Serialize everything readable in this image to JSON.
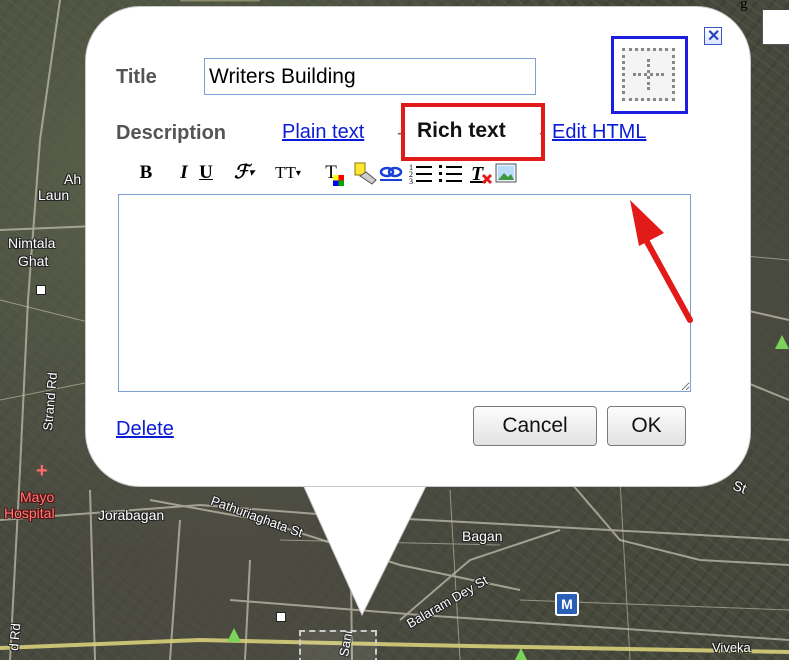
{
  "map": {
    "labels": {
      "ah": "Ah",
      "laun": "Laun",
      "nimtala": "Nimtala",
      "ghat": "Ghat",
      "strand_rd": "Strand Rd",
      "d_rd": "d Rd",
      "mayo": "Mayo",
      "hospital": "Hospital",
      "jorabagan": "Jorabagan",
      "pathuriaghata": "Pathuriaghata St",
      "bagan": "Bagan",
      "balaram": "Balaram Dey St",
      "st": "St",
      "vivek": "Viveka",
      "sani": "Sani",
      "top_corner_text": "g"
    },
    "metro_badge": "M"
  },
  "dialog": {
    "title_label": "Title",
    "title_value": "Writers Building",
    "description_label": "Description",
    "tabs": {
      "plain": "Plain text",
      "rich": "Rich text",
      "html": "Edit HTML",
      "sep1": "-",
      "sep2": "-"
    },
    "toolbar": {
      "bold": "B",
      "italic": "I",
      "underline": "U",
      "font": "ℱ",
      "size": "TT",
      "color": "T"
    },
    "editor_text": "",
    "delete_label": "Delete",
    "cancel_label": "Cancel",
    "ok_label": "OK",
    "close_glyph": "✕"
  },
  "colors": {
    "link": "#0b1cd6",
    "highlight_box": "#e21a1a",
    "icon_border": "#1d1de0",
    "arrow": "#e21a1a"
  }
}
